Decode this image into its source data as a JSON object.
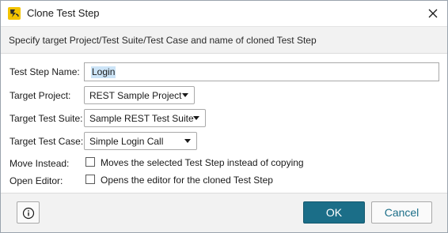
{
  "window": {
    "title": "Clone Test Step",
    "app_icon": "readyapi-bolt-icon",
    "close_icon": "close-icon"
  },
  "banner": {
    "text": "Specify target Project/Test Suite/Test Case and name of cloned Test Step"
  },
  "form": {
    "step_name": {
      "label": "Test Step Name:",
      "value": "Login"
    },
    "target_project": {
      "label": "Target Project:",
      "value": "REST Sample Project"
    },
    "target_suite": {
      "label": "Target Test Suite:",
      "value": "Sample REST Test Suite"
    },
    "target_case": {
      "label": "Target Test Case:",
      "value": "Simple Login Call"
    },
    "move_instead": {
      "label": "Move Instead:",
      "checkbox_label": "Moves the selected Test Step instead of copying",
      "checked": false
    },
    "open_editor": {
      "label": "Open Editor:",
      "checkbox_label": "Opens the editor for the cloned Test Step",
      "checked": false
    }
  },
  "footer": {
    "info_icon": "info-icon",
    "ok_label": "OK",
    "cancel_label": "Cancel"
  },
  "colors": {
    "accent": "#1b6e88",
    "banner_bg": "#f2f2f2",
    "selection": "#cce4f7"
  }
}
